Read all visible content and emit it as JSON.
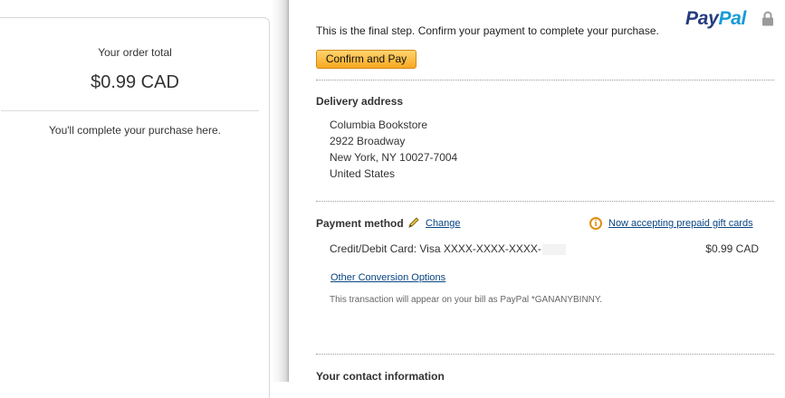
{
  "summary": {
    "order_total_label": "Your order total",
    "order_total_value": "$0.99 CAD",
    "complete_text": "You'll complete your purchase here."
  },
  "header": {
    "logo_pay": "Pay",
    "logo_pal": "Pal",
    "lock_icon": "lock-icon"
  },
  "main": {
    "final_step_text": "This is the final step. Confirm your payment to complete your purchase.",
    "confirm_button_label": "Confirm and Pay"
  },
  "delivery": {
    "heading": "Delivery address",
    "lines": [
      "Columbia Bookstore",
      "2922 Broadway",
      "New York, NY 10027-7004",
      "United States"
    ]
  },
  "payment": {
    "heading": "Payment method",
    "edit_icon": "pencil-icon",
    "change_label": "Change",
    "info_icon": "info-icon",
    "gift_cards_label": "Now accepting prepaid gift cards",
    "card_label": "Credit/Debit Card: Visa XXXX-XXXX-XXXX-",
    "amount": "$0.99 CAD",
    "conversion_label": "Other Conversion Options",
    "transaction_note": "This transaction will appear on your bill as PayPal *GANANYBINNY."
  },
  "contact": {
    "heading": "Your contact information"
  },
  "colors": {
    "button_top": "#fed46e",
    "button_bottom": "#f8a821",
    "link": "#084482",
    "paypal_dark": "#253b80",
    "paypal_light": "#179bd7",
    "info_orange": "#e08e12"
  }
}
